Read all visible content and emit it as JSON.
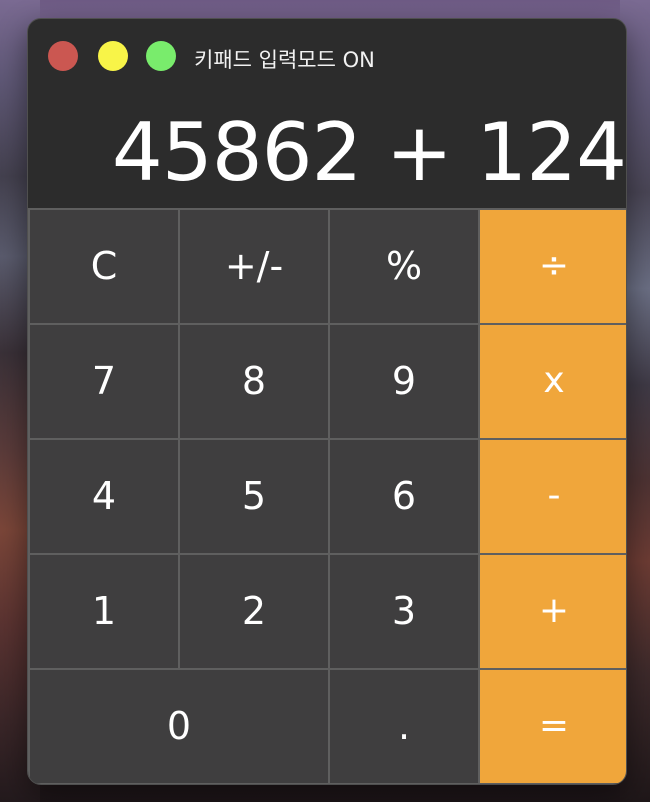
{
  "window": {
    "title": "키패드 입력모드 ON"
  },
  "display": {
    "value": "45862 + 124"
  },
  "keys": {
    "clear": "C",
    "sign": "+/-",
    "percent": "%",
    "divide": "÷",
    "seven": "7",
    "eight": "8",
    "nine": "9",
    "multiply": "x",
    "four": "4",
    "five": "5",
    "six": "6",
    "minus": "-",
    "one": "1",
    "two": "2",
    "three": "3",
    "plus": "+",
    "zero": "0",
    "decimal": ".",
    "equals": "="
  },
  "colors": {
    "operator": "#f0a63b",
    "key": "#3f3e3f",
    "window": "#2c2c2c",
    "close": "#cb5751",
    "minimize": "#f8f448",
    "zoom": "#79ec6c"
  }
}
